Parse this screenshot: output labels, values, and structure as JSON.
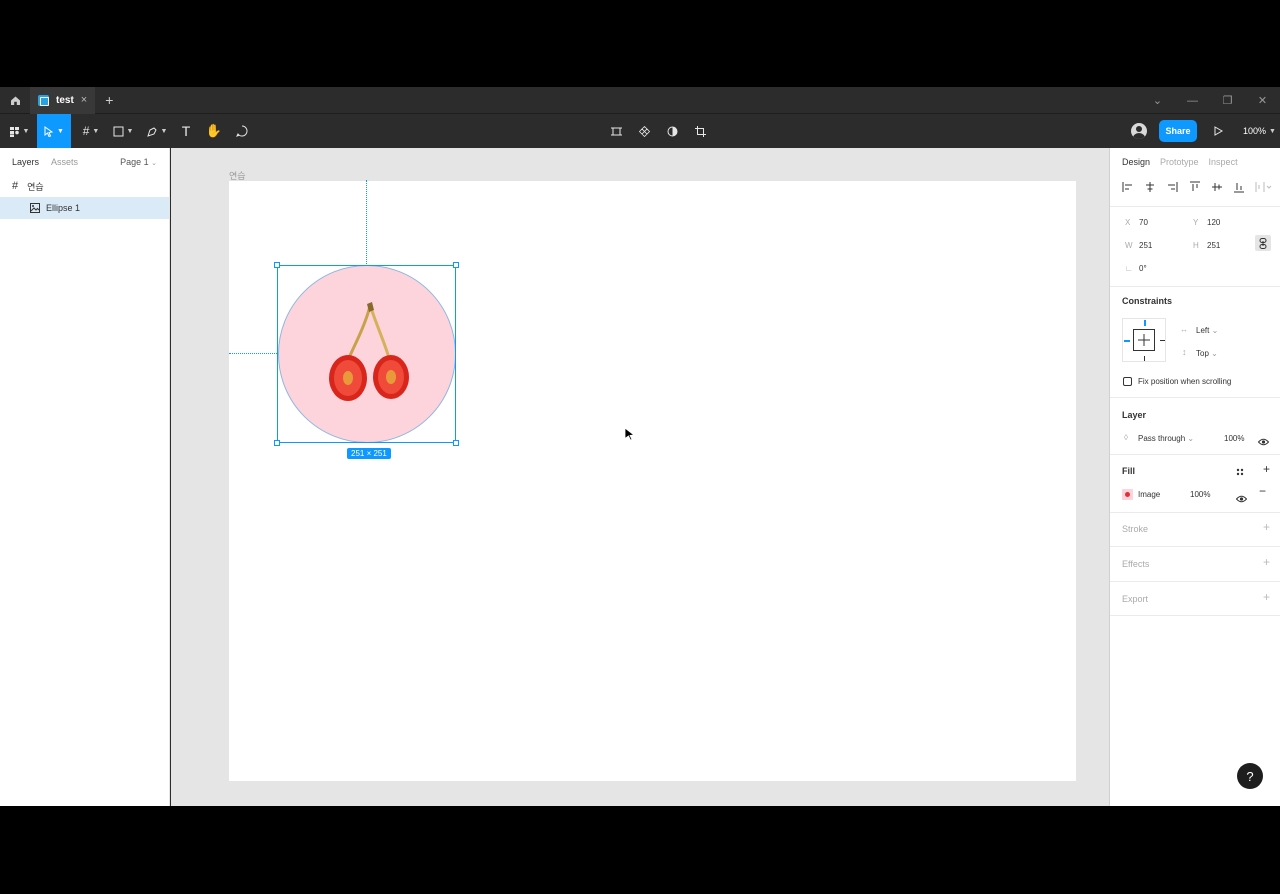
{
  "titlebar": {
    "tab_label": "test",
    "tab_close": "×",
    "new_tab": "+"
  },
  "toolbar": {
    "share_label": "Share",
    "zoom_label": "100%"
  },
  "left_panel": {
    "tab_layers": "Layers",
    "tab_assets": "Assets",
    "page_selector": "Page 1",
    "layers": [
      {
        "name": "연습",
        "type": "frame"
      },
      {
        "name": "Ellipse 1",
        "type": "ellipse-image",
        "selected": true
      }
    ]
  },
  "canvas": {
    "frame_label": "연습",
    "size_badge": "251 × 251"
  },
  "right_panel": {
    "tab_design": "Design",
    "tab_prototype": "Prototype",
    "tab_inspect": "Inspect",
    "x_label": "X",
    "x_value": "70",
    "y_label": "Y",
    "y_value": "120",
    "w_label": "W",
    "w_value": "251",
    "h_label": "H",
    "h_value": "251",
    "rotation_value": "0°",
    "constraints_title": "Constraints",
    "constraint_h": "Left",
    "constraint_v": "Top",
    "fix_position_label": "Fix position when scrolling",
    "layer_title": "Layer",
    "blend_mode": "Pass through",
    "layer_opacity": "100%",
    "fill_title": "Fill",
    "fill_type": "Image",
    "fill_opacity": "100%",
    "stroke_title": "Stroke",
    "effects_title": "Effects",
    "export_title": "Export"
  },
  "help_label": "?",
  "colors": {
    "accent": "#0d99ff",
    "dark_chrome": "#2c2c2c",
    "canvas_bg": "#e5e5e5",
    "ellipse_fill": "#fdd4dc"
  }
}
